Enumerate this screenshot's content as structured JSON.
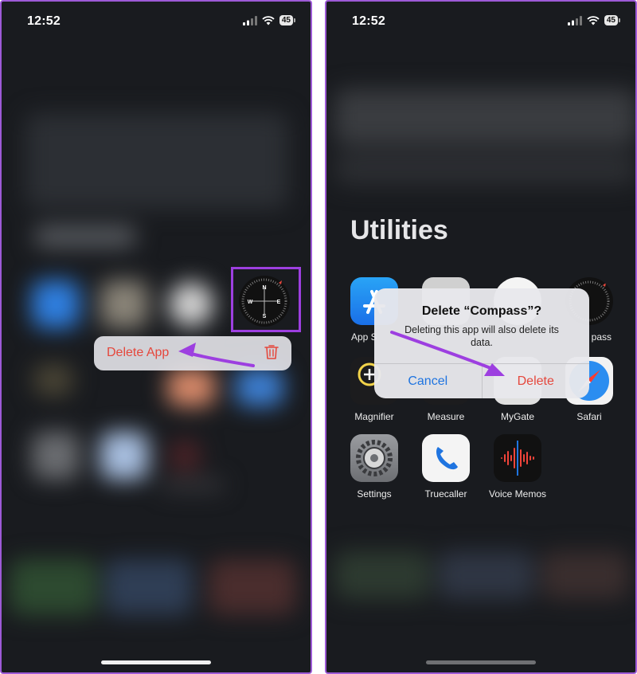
{
  "left_screen": {
    "status_bar": {
      "time": "12:52",
      "battery": "45"
    },
    "context_menu": {
      "label": "Delete App",
      "icon": "trash-icon",
      "color": "#e5473c"
    },
    "highlight_color": "#9d3fe0",
    "compass_letters": {
      "n": "N",
      "e": "E",
      "s": "S",
      "w": "W"
    }
  },
  "right_screen": {
    "status_bar": {
      "time": "12:52",
      "battery": "45"
    },
    "folder_title": "Utilities",
    "apps": {
      "app_store": "App S",
      "compass": "pass",
      "magnifier": "Magnifier",
      "measure": "Measure",
      "mygate": "MyGate",
      "safari": "Safari",
      "settings": "Settings",
      "truecaller": "Truecaller",
      "voice_memos": "Voice Memos"
    },
    "alert": {
      "title": "Delete “Compass”?",
      "message": "Deleting this app will also delete its data.",
      "cancel_label": "Cancel",
      "delete_label": "Delete"
    }
  },
  "colors": {
    "accent_purple": "#9d3fe0",
    "destructive_red": "#e5473c",
    "ios_blue": "#1f74e0"
  }
}
